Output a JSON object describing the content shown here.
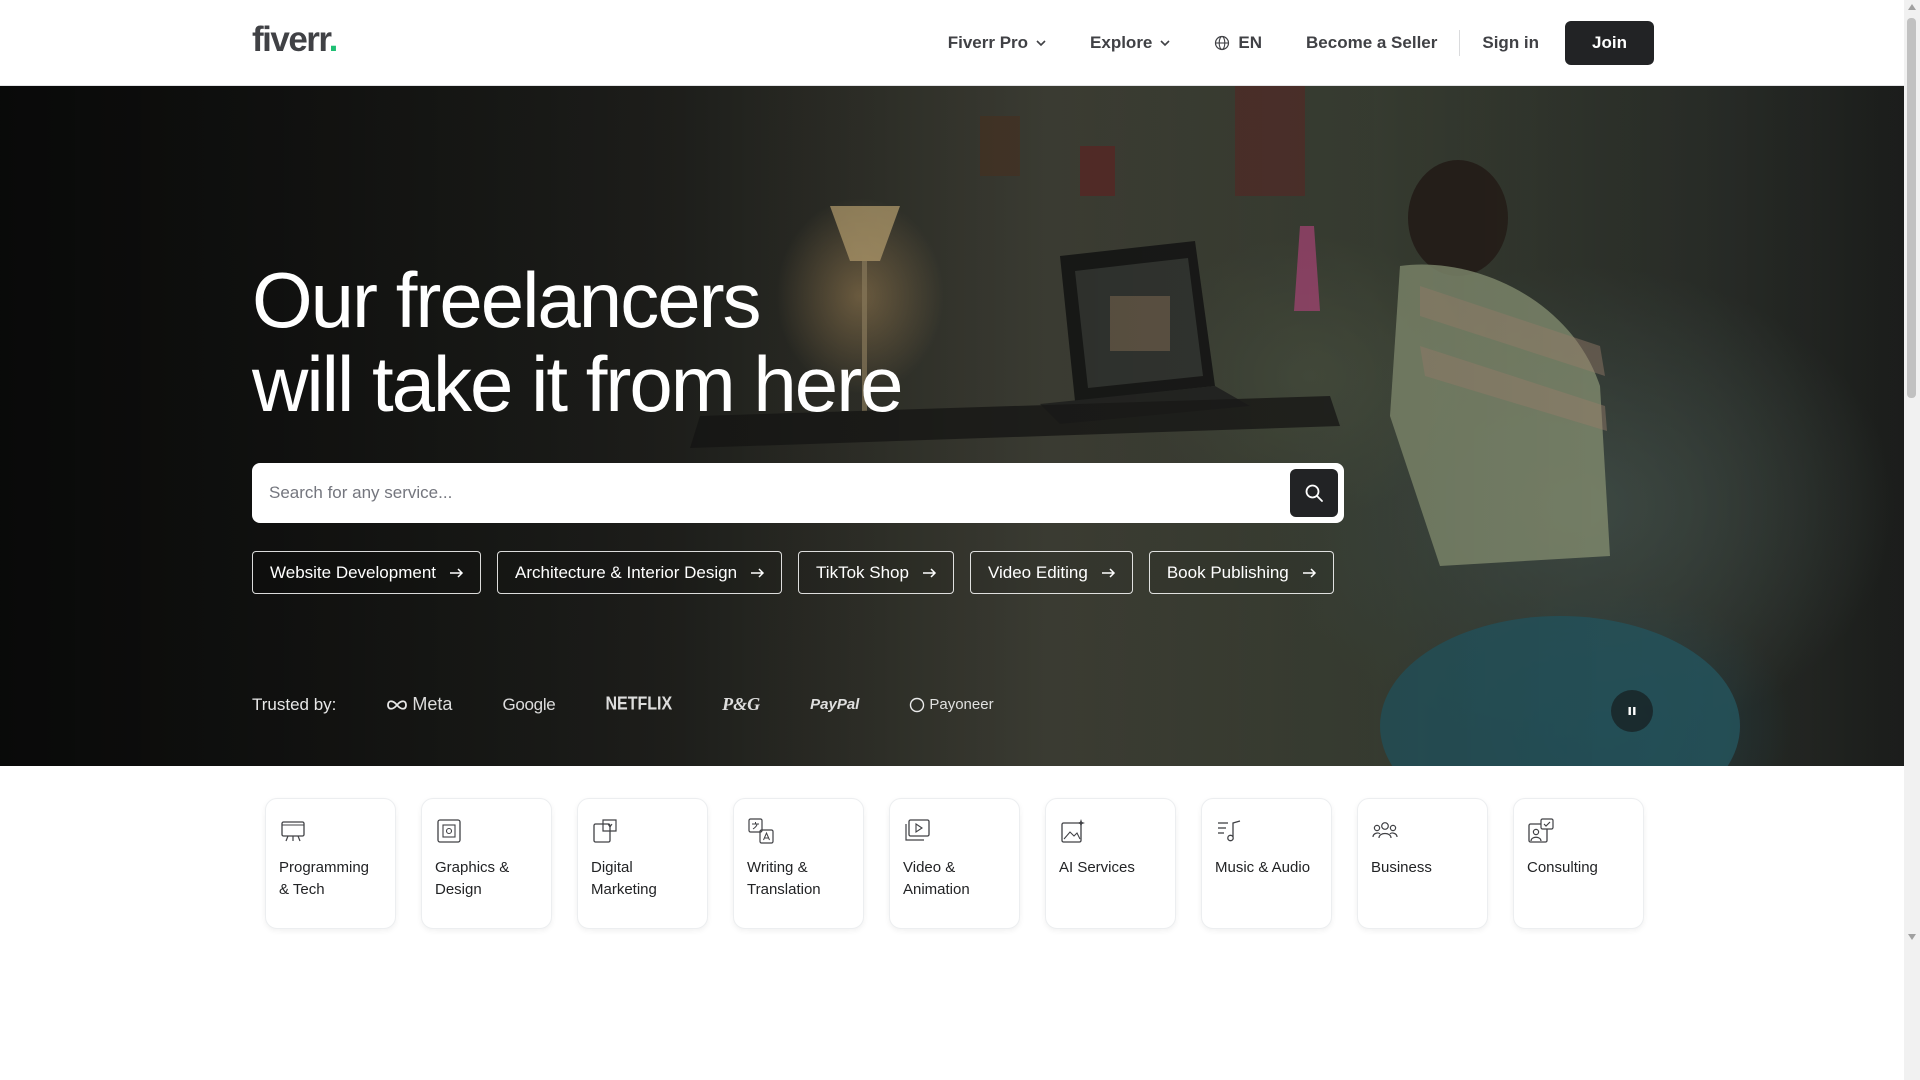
{
  "header": {
    "logo_text": "fiverr",
    "logo_dot": ".",
    "nav": {
      "fiverr_pro": "Fiverr Pro",
      "explore": "Explore",
      "language": "EN",
      "become_seller": "Become a Seller",
      "sign_in": "Sign in",
      "join": "Join"
    }
  },
  "hero": {
    "title_line1": "Our freelancers",
    "title_line2": "will take it from here",
    "search_placeholder": "Search for any service...",
    "chips": [
      "Website Development",
      "Architecture & Interior Design",
      "TikTok Shop",
      "Video Editing",
      "Book Publishing"
    ],
    "trusted_label": "Trusted by:",
    "brands": [
      "Meta",
      "Google",
      "NETFLIX",
      "P&G",
      "PayPal",
      "Payoneer"
    ]
  },
  "categories": [
    {
      "label": "Programming & Tech",
      "icon": "code-monitor-icon"
    },
    {
      "label": "Graphics & Design",
      "icon": "design-tool-icon"
    },
    {
      "label": "Digital Marketing",
      "icon": "marketing-icon"
    },
    {
      "label": "Writing & Translation",
      "icon": "translation-icon"
    },
    {
      "label": "Video & Animation",
      "icon": "video-play-icon"
    },
    {
      "label": "AI Services",
      "icon": "ai-sparkle-icon"
    },
    {
      "label": "Music & Audio",
      "icon": "music-note-icon"
    },
    {
      "label": "Business",
      "icon": "people-group-icon"
    },
    {
      "label": "Consulting",
      "icon": "consulting-icon"
    }
  ],
  "colors": {
    "brand_green": "#1dbf73",
    "dark": "#222325",
    "text": "#404145"
  }
}
